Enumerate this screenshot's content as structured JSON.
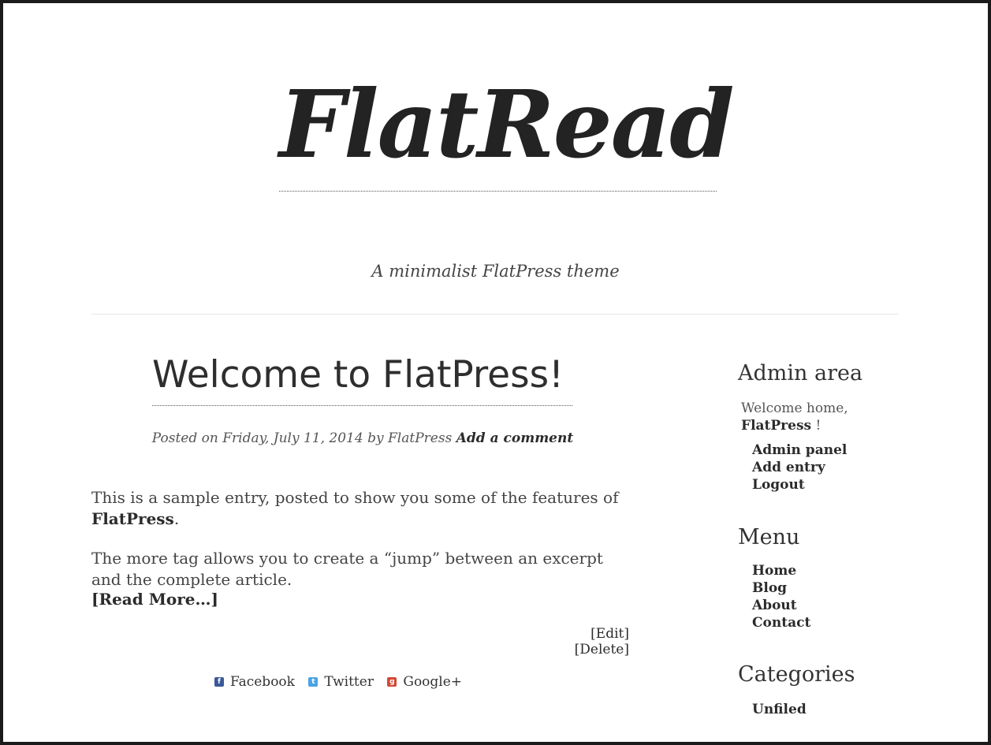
{
  "header": {
    "site_title": "FlatRead",
    "tagline": "A minimalist FlatPress theme"
  },
  "entry": {
    "title": "Welcome to FlatPress!",
    "meta_prefix": "Posted on",
    "date": "Friday, July 11, 2014",
    "by": "by",
    "author": "FlatPress",
    "comment_link": "Add a comment",
    "para1_text": "This is a sample entry, posted to show you some of the features of",
    "para1_strong": "FlatPress",
    "para1_end": ".",
    "para2": "The more tag allows you to create a “jump” between an excerpt and the complete article.",
    "read_more": "[Read More…]",
    "edit_label": "[Edit]",
    "delete_label": "[Delete]"
  },
  "share": [
    {
      "label": "Facebook",
      "icon": "facebook-icon",
      "color": "#3b5998",
      "glyph": "f"
    },
    {
      "label": "Twitter",
      "icon": "twitter-icon",
      "color": "#4ba3e3",
      "glyph": "t"
    },
    {
      "label": "Google+",
      "icon": "google-plus-icon",
      "color": "#d34836",
      "glyph": "g"
    }
  ],
  "sidebar": {
    "admin": {
      "title": "Admin area",
      "welcome_text": "Welcome home,",
      "welcome_user": "FlatPress",
      "welcome_end": " !",
      "links": [
        "Admin panel",
        "Add entry",
        "Logout"
      ]
    },
    "menu": {
      "title": "Menu",
      "links": [
        "Home",
        "Blog",
        "About",
        "Contact"
      ]
    },
    "categories": {
      "title": "Categories",
      "links": [
        "Unfiled"
      ]
    }
  }
}
